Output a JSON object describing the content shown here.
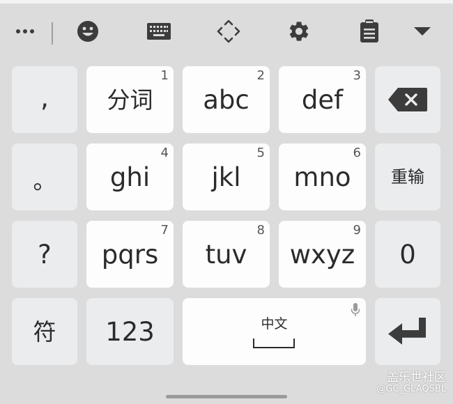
{
  "toolbar": {
    "items": [
      {
        "icon": "more-horizontal-icon"
      },
      {
        "icon": "emoji-icon"
      },
      {
        "icon": "keyboard-icon"
      },
      {
        "icon": "move-arrows-icon"
      },
      {
        "icon": "settings-gear-icon"
      },
      {
        "icon": "clipboard-icon"
      },
      {
        "icon": "collapse-triangle-icon"
      }
    ]
  },
  "keys": {
    "comma": {
      "label": ","
    },
    "k1": {
      "label": "分词",
      "num": "1"
    },
    "k2": {
      "label": "abc",
      "num": "2"
    },
    "k3": {
      "label": "def",
      "num": "3"
    },
    "backspace": {
      "icon": "backspace-icon"
    },
    "period": {
      "label": "。"
    },
    "k4": {
      "label": "ghi",
      "num": "4"
    },
    "k5": {
      "label": "jkl",
      "num": "5"
    },
    "k6": {
      "label": "mno",
      "num": "6"
    },
    "reinput": {
      "label": "重输"
    },
    "question": {
      "label": "?"
    },
    "k7": {
      "label": "pqrs",
      "num": "7"
    },
    "k8": {
      "label": "tuv",
      "num": "8"
    },
    "k9": {
      "label": "wxyz",
      "num": "9"
    },
    "zero": {
      "label": "0"
    },
    "symbols": {
      "label": "符"
    },
    "numbers": {
      "label": "123"
    },
    "space": {
      "label": "中文",
      "icon": "microphone-icon"
    },
    "enter": {
      "icon": "enter-arrow-icon"
    }
  },
  "watermark": {
    "line1": "盖乐世社区",
    "line2": "@GC_GLAQSBL"
  },
  "colors": {
    "background": "#dcdcdc",
    "key_light": "#fdfdfd",
    "key_dark": "#ebecee",
    "icon": "#3c3c3c"
  }
}
